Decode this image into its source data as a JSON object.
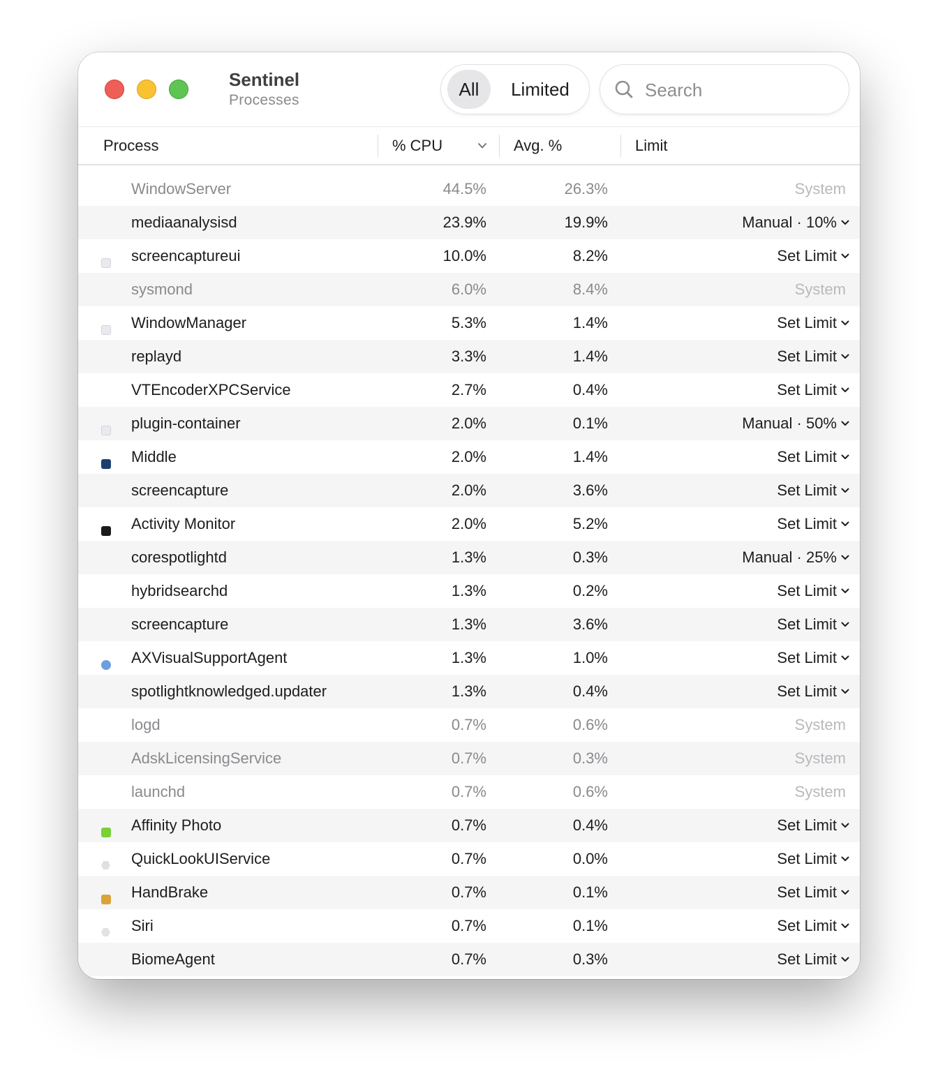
{
  "app": {
    "title": "Sentinel",
    "subtitle": "Processes"
  },
  "filters": {
    "options": [
      "All",
      "Limited"
    ],
    "selected": "All"
  },
  "search": {
    "placeholder": "Search",
    "value": ""
  },
  "columns": {
    "process": "Process",
    "cpu": "% CPU",
    "avg": "Avg. %",
    "limit": "Limit"
  },
  "processes": [
    {
      "name": "WindowServer",
      "cpu": "44.5%",
      "avg": "26.3%",
      "limit": "System",
      "system": true,
      "icon": ""
    },
    {
      "name": "mediaanalysisd",
      "cpu": "23.9%",
      "avg": "19.9%",
      "limit": "Manual · 10%",
      "system": false,
      "icon": ""
    },
    {
      "name": "screencaptureui",
      "cpu": "10.0%",
      "avg": "8.2%",
      "limit": "Set Limit",
      "system": false,
      "icon": "generic-app-icon"
    },
    {
      "name": "sysmond",
      "cpu": "6.0%",
      "avg": "8.4%",
      "limit": "System",
      "system": true,
      "icon": ""
    },
    {
      "name": "WindowManager",
      "cpu": "5.3%",
      "avg": "1.4%",
      "limit": "Set Limit",
      "system": false,
      "icon": "generic-app-icon"
    },
    {
      "name": "replayd",
      "cpu": "3.3%",
      "avg": "1.4%",
      "limit": "Set Limit",
      "system": false,
      "icon": ""
    },
    {
      "name": "VTEncoderXPCService",
      "cpu": "2.7%",
      "avg": "0.4%",
      "limit": "Set Limit",
      "system": false,
      "icon": ""
    },
    {
      "name": "plugin-container",
      "cpu": "2.0%",
      "avg": "0.1%",
      "limit": "Manual · 50%",
      "system": false,
      "icon": "generic-app-icon"
    },
    {
      "name": "Middle",
      "cpu": "2.0%",
      "avg": "1.4%",
      "limit": "Set Limit",
      "system": false,
      "icon": "middle-app-icon"
    },
    {
      "name": "screencapture",
      "cpu": "2.0%",
      "avg": "3.6%",
      "limit": "Set Limit",
      "system": false,
      "icon": ""
    },
    {
      "name": "Activity Monitor",
      "cpu": "2.0%",
      "avg": "5.2%",
      "limit": "Set Limit",
      "system": false,
      "icon": "activity-monitor-icon"
    },
    {
      "name": "corespotlightd",
      "cpu": "1.3%",
      "avg": "0.3%",
      "limit": "Manual · 25%",
      "system": false,
      "icon": ""
    },
    {
      "name": "hybridsearchd",
      "cpu": "1.3%",
      "avg": "0.2%",
      "limit": "Set Limit",
      "system": false,
      "icon": ""
    },
    {
      "name": "screencapture",
      "cpu": "1.3%",
      "avg": "3.6%",
      "limit": "Set Limit",
      "system": false,
      "icon": ""
    },
    {
      "name": "AXVisualSupportAgent",
      "cpu": "1.3%",
      "avg": "1.0%",
      "limit": "Set Limit",
      "system": false,
      "icon": "accessibility-icon"
    },
    {
      "name": "spotlightknowledged.updater",
      "cpu": "1.3%",
      "avg": "0.4%",
      "limit": "Set Limit",
      "system": false,
      "icon": ""
    },
    {
      "name": "logd",
      "cpu": "0.7%",
      "avg": "0.6%",
      "limit": "System",
      "system": true,
      "icon": ""
    },
    {
      "name": "AdskLicensingService",
      "cpu": "0.7%",
      "avg": "0.3%",
      "limit": "System",
      "system": true,
      "icon": ""
    },
    {
      "name": "launchd",
      "cpu": "0.7%",
      "avg": "0.6%",
      "limit": "System",
      "system": true,
      "icon": ""
    },
    {
      "name": "Affinity Photo",
      "cpu": "0.7%",
      "avg": "0.4%",
      "limit": "Set Limit",
      "system": false,
      "icon": "affinity-photo-icon"
    },
    {
      "name": "QuickLookUIService",
      "cpu": "0.7%",
      "avg": "0.0%",
      "limit": "Set Limit",
      "system": false,
      "icon": "quicklook-icon"
    },
    {
      "name": "HandBrake",
      "cpu": "0.7%",
      "avg": "0.1%",
      "limit": "Set Limit",
      "system": false,
      "icon": "handbrake-icon"
    },
    {
      "name": "Siri",
      "cpu": "0.7%",
      "avg": "0.1%",
      "limit": "Set Limit",
      "system": false,
      "icon": "siri-icon"
    },
    {
      "name": "BiomeAgent",
      "cpu": "0.7%",
      "avg": "0.3%",
      "limit": "Set Limit",
      "system": false,
      "icon": ""
    }
  ]
}
